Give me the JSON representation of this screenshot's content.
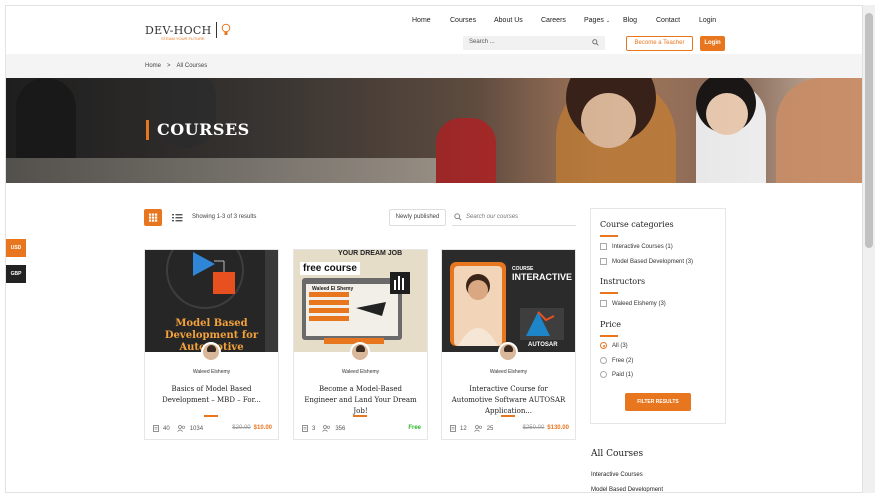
{
  "header": {
    "logo_text": "DEV-HOCH",
    "logo_tagline": "STEAM YOUR FUTURE",
    "nav": [
      "Home",
      "Courses",
      "About Us",
      "Careers",
      "Pages",
      "Blog",
      "Contact",
      "Login"
    ],
    "search_placeholder": "Search ...",
    "become_teacher": "Become a Teacher",
    "login_button": "Login"
  },
  "breadcrumb": {
    "home": "Home",
    "sep": ">",
    "current": "All Courses"
  },
  "hero": {
    "title": "COURSES"
  },
  "currency": {
    "usd": "USD",
    "gbp": "GBP"
  },
  "toolbar": {
    "showing": "Showing 1-3 of 3 results",
    "sort": "Newly published",
    "search_placeholder": "Search our courses"
  },
  "courses": [
    {
      "instructor": "Waleed Elshemy",
      "title": "Basics of Model Based Development – MBD – For...",
      "lessons": "40",
      "students": "1034",
      "old_price": "$20.00",
      "price": "$10.00",
      "thumb_text": "Model Based Development for Automotive"
    },
    {
      "instructor": "Waleed Elshemy",
      "title": "Become a Model-Based Engineer and Land Your Dream Job!",
      "lessons": "3",
      "students": "356",
      "old_price": "",
      "price": "Free",
      "thumb_top": "YOUR DREAM JOB",
      "thumb_badge": "free course",
      "thumb_name": "Waleed El Shemy"
    },
    {
      "instructor": "Waleed Elshemy",
      "title": "Interactive Course for Automotive Software AUTOSAR Application...",
      "lessons": "12",
      "students": "25",
      "old_price": "$250.00",
      "price": "$130.00",
      "thumb_small": "COURSE",
      "thumb_big": "INTERACTIVE",
      "thumb_brand": "AUTOSAR"
    }
  ],
  "filters": {
    "categories_title": "Course categories",
    "categories": [
      "Interactive Courses (1)",
      "Model Based Development (3)"
    ],
    "instructors_title": "Instructors",
    "instructors": [
      "Waleed Elshemy (3)"
    ],
    "price_title": "Price",
    "prices": [
      "All (3)",
      "Free (2)",
      "Paid (1)"
    ],
    "button": "FILTER RESULTS"
  },
  "all_courses": {
    "title": "All Courses",
    "items": [
      "Interactive Courses",
      "Model Based Development"
    ]
  },
  "colors": {
    "accent": "#e8761f",
    "free": "#2ab52a",
    "dark": "#222222"
  }
}
